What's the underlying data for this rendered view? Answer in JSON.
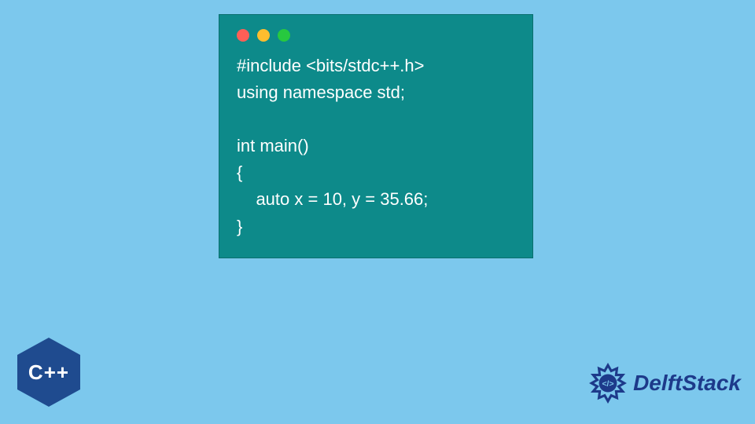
{
  "code_window": {
    "lines": [
      "#include <bits/stdc++.h>",
      "using namespace std;",
      "",
      "int main()",
      "{",
      "    auto x = 10, y = 35.66;",
      "}"
    ]
  },
  "cpp_badge": {
    "label": "C++"
  },
  "brand": {
    "name": "DelftStack"
  },
  "colors": {
    "background": "#7cc8ed",
    "window": "#0d8a8a",
    "brand_text": "#1d3a8a",
    "cpp_hex": "#1f4b8f"
  }
}
